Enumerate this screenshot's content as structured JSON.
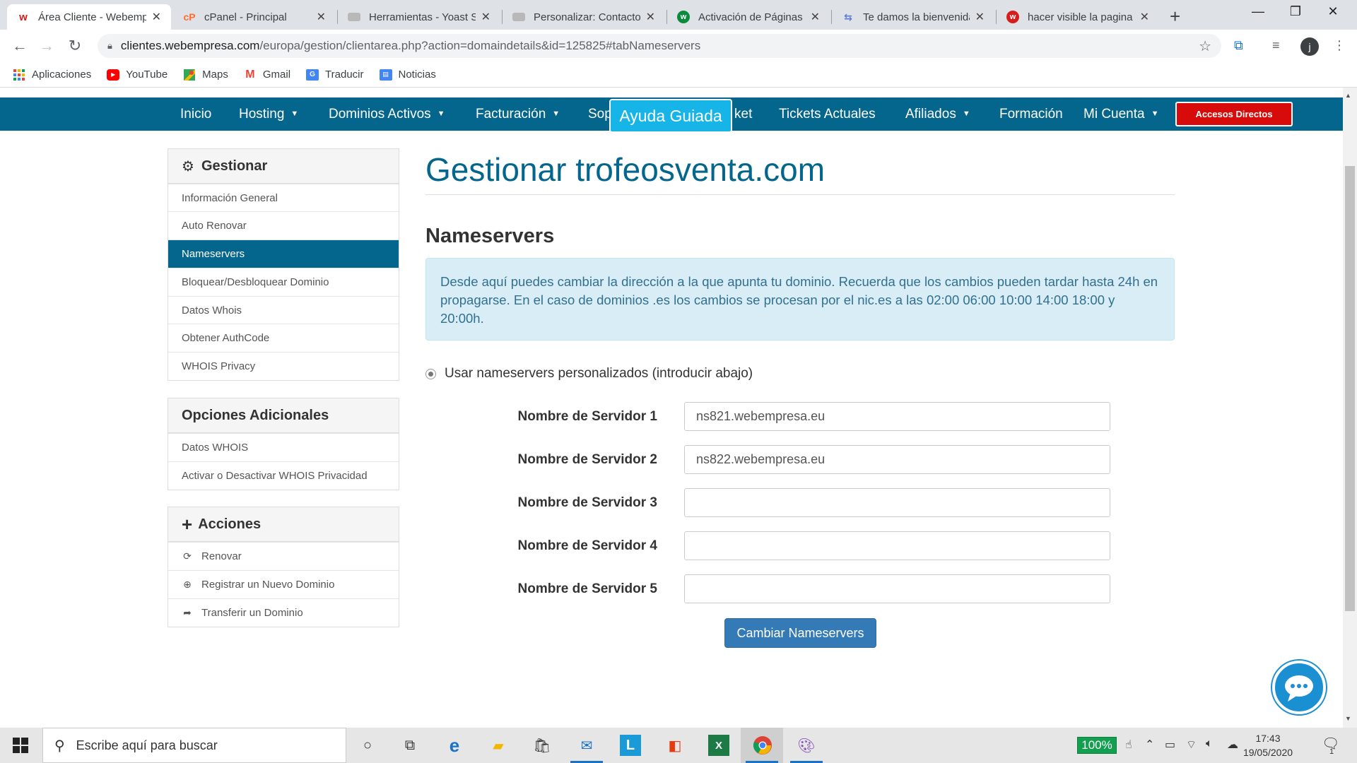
{
  "browser": {
    "tabs": [
      {
        "title": "Área Cliente - Webempresa",
        "favicon": "webempresa-icon",
        "fav_color": "#d81b1b",
        "fav_text": "w",
        "active": true
      },
      {
        "title": "cPanel - Principal",
        "favicon": "cpanel-icon",
        "fav_color": "#ff6c2c",
        "fav_text": "cP"
      },
      {
        "title": "Herramientas - Yoast SEO",
        "favicon": "wordpress-icon",
        "fav_color": "#8a8a8a",
        "fav_text": ""
      },
      {
        "title": "Personalizar: Contacto",
        "favicon": "wordpress-icon",
        "fav_color": "#8a8a8a",
        "fav_text": ""
      },
      {
        "title": "Activación de Páginas AMP",
        "favicon": "webempresa-green-icon",
        "fav_color": "#0a8a3a",
        "fav_text": "w"
      },
      {
        "title": "Te damos la bienvenida",
        "favicon": "translate-icon",
        "fav_color": "#5a7bd6",
        "fav_text": ""
      },
      {
        "title": "hacer visible la pagina",
        "favicon": "webempresa-icon",
        "fav_color": "#d81b1b",
        "fav_text": "w"
      }
    ],
    "url_host": "clientes.webempresa.com",
    "url_path": "/europa/gestion/clientarea.php?action=domaindetails&id=125825#tabNameservers",
    "profile_initial": "j",
    "bookmarks": [
      {
        "label": "Aplicaciones",
        "icon": "apps-grid-icon"
      },
      {
        "label": "YouTube",
        "icon": "youtube-icon"
      },
      {
        "label": "Maps",
        "icon": "maps-icon"
      },
      {
        "label": "Gmail",
        "icon": "gmail-icon"
      },
      {
        "label": "Traducir",
        "icon": "translate-icon"
      },
      {
        "label": "Noticias",
        "icon": "news-icon"
      }
    ]
  },
  "nav": {
    "inicio": "Inicio",
    "hosting": "Hosting",
    "dominios": "Dominios Activos",
    "facturacion": "Facturación",
    "soporte": "Sop",
    "ticket": "ket",
    "tickets": "Tickets Actuales",
    "afiliados": "Afiliados",
    "formacion": "Formación",
    "micuenta": "Mi Cuenta",
    "accesos": "Accesos Directos",
    "ayuda": "Ayuda Guiada",
    "brand_color": "#05668d"
  },
  "sidebar": {
    "gestionar": {
      "title": "Gestionar",
      "items": [
        "Información General",
        "Auto Renovar",
        "Nameservers",
        "Bloquear/Desbloquear Dominio",
        "Datos Whois",
        "Obtener AuthCode",
        "WHOIS Privacy"
      ],
      "active_index": 2
    },
    "opciones": {
      "title": "Opciones Adicionales",
      "items": [
        "Datos WHOIS",
        "Activar o Desactivar WHOIS Privacidad"
      ]
    },
    "acciones": {
      "title": "Acciones",
      "items": [
        {
          "label": "Renovar",
          "icon": "refresh-icon"
        },
        {
          "label": "Registrar un Nuevo Dominio",
          "icon": "globe-icon"
        },
        {
          "label": "Transferir un Dominio",
          "icon": "share-arrow-icon"
        }
      ]
    }
  },
  "main": {
    "title": "Gestionar trofeosventa.com",
    "section": "Nameservers",
    "info": "Desde aquí puedes cambiar la dirección a la que apunta tu dominio. Recuerda que los cambios pueden tardar hasta 24h en propagarse. En el caso de dominios .es los cambios se procesan por el nic.es a las 02:00 06:00 10:00 14:00 18:00 y 20:00h.",
    "radio_label": "Usar nameservers personalizados (introducir abajo)",
    "servers": [
      {
        "label": "Nombre de Servidor 1",
        "value": "ns821.webempresa.eu"
      },
      {
        "label": "Nombre de Servidor 2",
        "value": "ns822.webempresa.eu"
      },
      {
        "label": "Nombre de Servidor 3",
        "value": ""
      },
      {
        "label": "Nombre de Servidor 4",
        "value": ""
      },
      {
        "label": "Nombre de Servidor 5",
        "value": ""
      }
    ],
    "submit": "Cambiar Nameservers"
  },
  "taskbar": {
    "search_placeholder": "Escribe aquí para buscar",
    "battery": "100%",
    "time": "17:43",
    "date": "19/05/2020",
    "notifications": "1"
  }
}
